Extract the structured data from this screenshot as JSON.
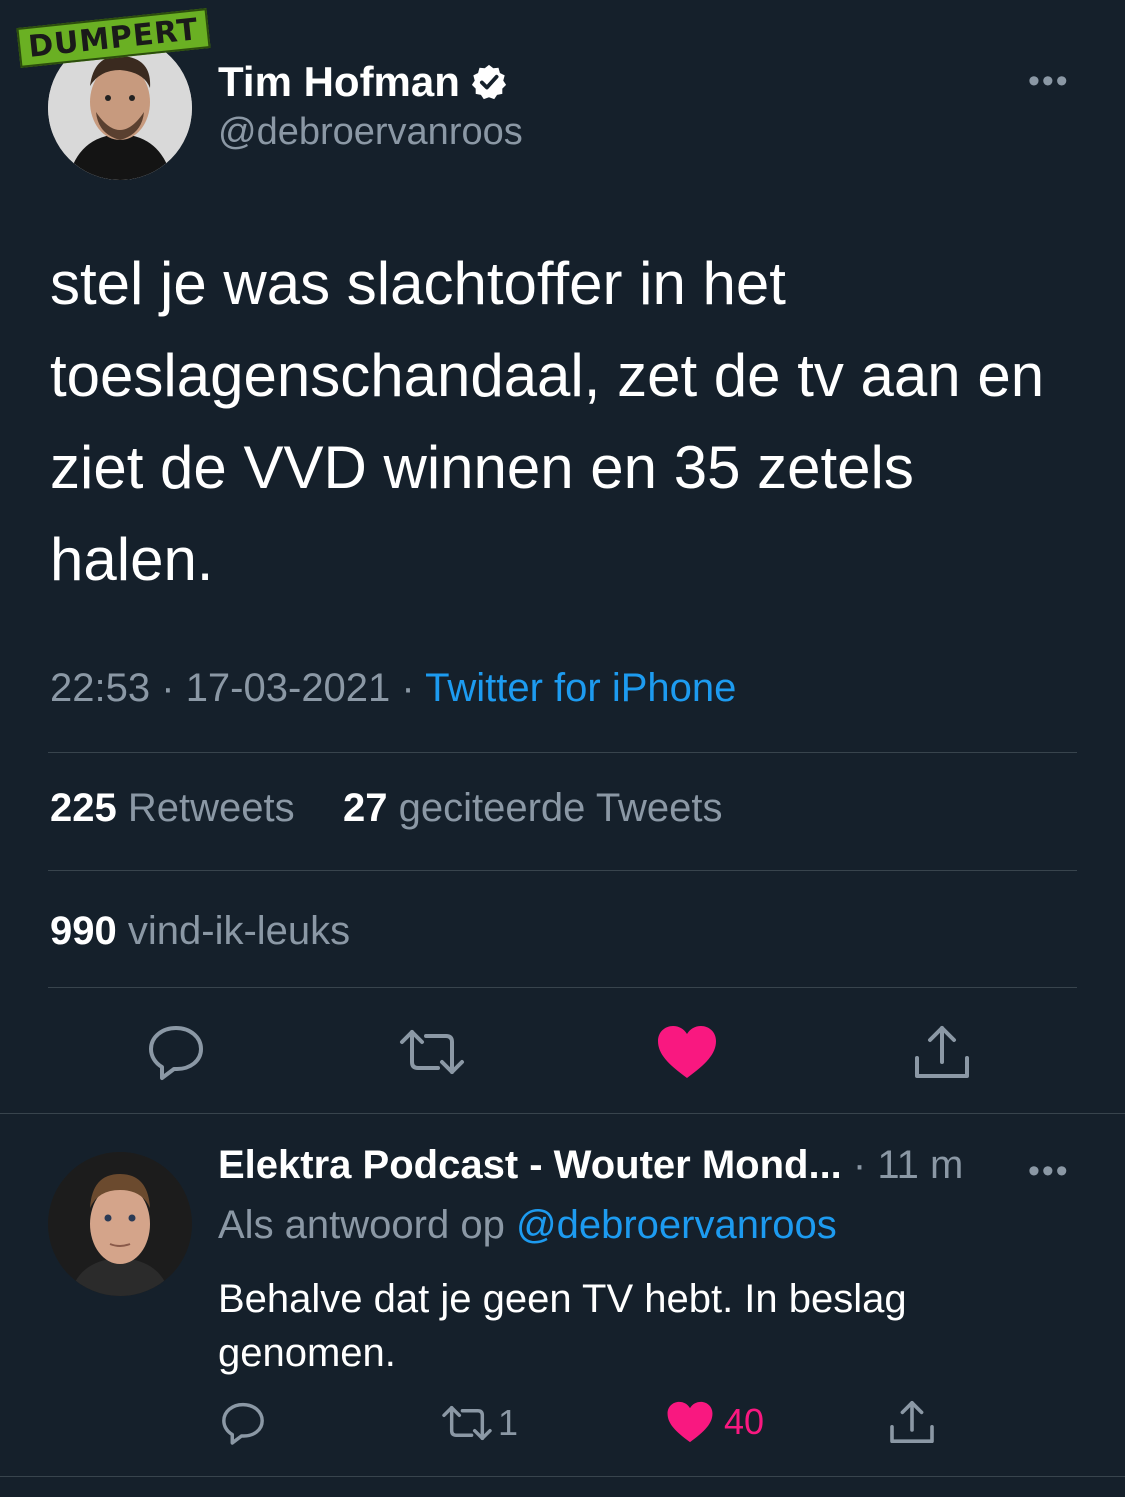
{
  "watermark": {
    "text": "DUMPERT",
    "color": "#6ab023"
  },
  "tweet": {
    "author_name": "Tim Hofman",
    "handle": "@debroervanroos",
    "verified": true,
    "text": "stel je was slachtoffer in het toeslagenschandaal, zet de tv aan en ziet de VVD winnen en 35 zetels halen.",
    "time": "22:53",
    "date": "17-03-2021",
    "separator": "·",
    "source": "Twitter for iPhone",
    "retweets_count": "225",
    "retweets_label": "Retweets",
    "quotes_count": "27",
    "quotes_label": "geciteerde Tweets",
    "likes_count": "990",
    "likes_label": "vind-ik-leuks",
    "more_label": "•••",
    "liked": true
  },
  "actions": [
    {
      "name": "reply-icon"
    },
    {
      "name": "retweet-icon"
    },
    {
      "name": "heart-icon",
      "color": "#f91880"
    },
    {
      "name": "share-icon"
    }
  ],
  "reply": {
    "author_name": "Elektra Podcast - Wouter Mond...",
    "time": "· 11 m",
    "reply_to_label": "Als antwoord op",
    "reply_to_handle": "@debroervanroos",
    "text": "Behalve dat je geen TV hebt. In beslag genomen.",
    "retweet_count": "1",
    "like_count": "40",
    "more_label": "•••"
  },
  "colors": {
    "background": "#15202b",
    "primary_text": "#ffffff",
    "secondary_text": "#8b98a5",
    "link": "#1d9bf0",
    "like": "#f91880",
    "divider": "#38444d"
  }
}
